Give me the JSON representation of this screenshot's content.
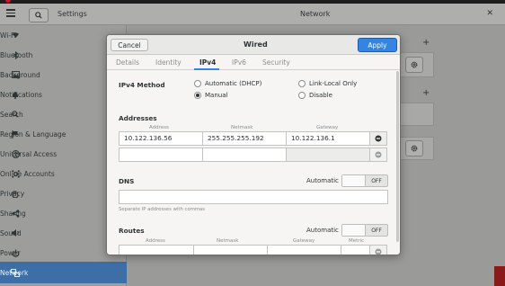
{
  "colors": {
    "accent": "#3584e4",
    "sidebar_active": "#3d6fa6"
  },
  "settings": {
    "title": "Settings",
    "sidebar": {
      "items": [
        {
          "label": "Wi-Fi",
          "icon": "wifi-icon"
        },
        {
          "label": "Bluetooth",
          "icon": "bluetooth-icon"
        },
        {
          "label": "Background",
          "icon": "background-icon"
        },
        {
          "label": "Notifications",
          "icon": "bell-icon"
        },
        {
          "label": "Search",
          "icon": "search-icon"
        },
        {
          "label": "Region & Language",
          "icon": "flag-icon"
        },
        {
          "label": "Universal Access",
          "icon": "accessibility-icon"
        },
        {
          "label": "Online Accounts",
          "icon": "accounts-icon"
        },
        {
          "label": "Privacy",
          "icon": "hand-icon"
        },
        {
          "label": "Sharing",
          "icon": "share-icon"
        },
        {
          "label": "Sound",
          "icon": "speaker-icon"
        },
        {
          "label": "Power",
          "icon": "power-icon"
        },
        {
          "label": "Network",
          "icon": "network-icon",
          "active": true
        }
      ]
    }
  },
  "network": {
    "title": "Network"
  },
  "dialog": {
    "title": "Wired",
    "cancel_label": "Cancel",
    "apply_label": "Apply",
    "tabs": [
      "Details",
      "Identity",
      "IPv4",
      "IPv6",
      "Security"
    ],
    "active_tab": "IPv4",
    "ipv4": {
      "method_label": "IPv4 Method",
      "methods": [
        "Automatic (DHCP)",
        "Link-Local Only",
        "Manual",
        "Disable"
      ],
      "selected_method": "Manual",
      "addresses_label": "Addresses",
      "address_columns": [
        "Address",
        "Netmask",
        "Gateway"
      ],
      "address_rows": [
        {
          "address": "10.122.136.56",
          "netmask": "255.255.255.192",
          "gateway": "10.122.136.1"
        },
        {
          "address": "",
          "netmask": "",
          "gateway": ""
        }
      ],
      "dns_label": "DNS",
      "dns_automatic_label": "Automatic",
      "dns_switch_state": "OFF",
      "dns_value": "",
      "dns_hint": "Separate IP addresses with commas",
      "routes_label": "Routes",
      "routes_automatic_label": "Automatic",
      "routes_switch_state": "OFF",
      "route_columns": [
        "Address",
        "Netmask",
        "Gateway",
        "Metric"
      ]
    }
  }
}
